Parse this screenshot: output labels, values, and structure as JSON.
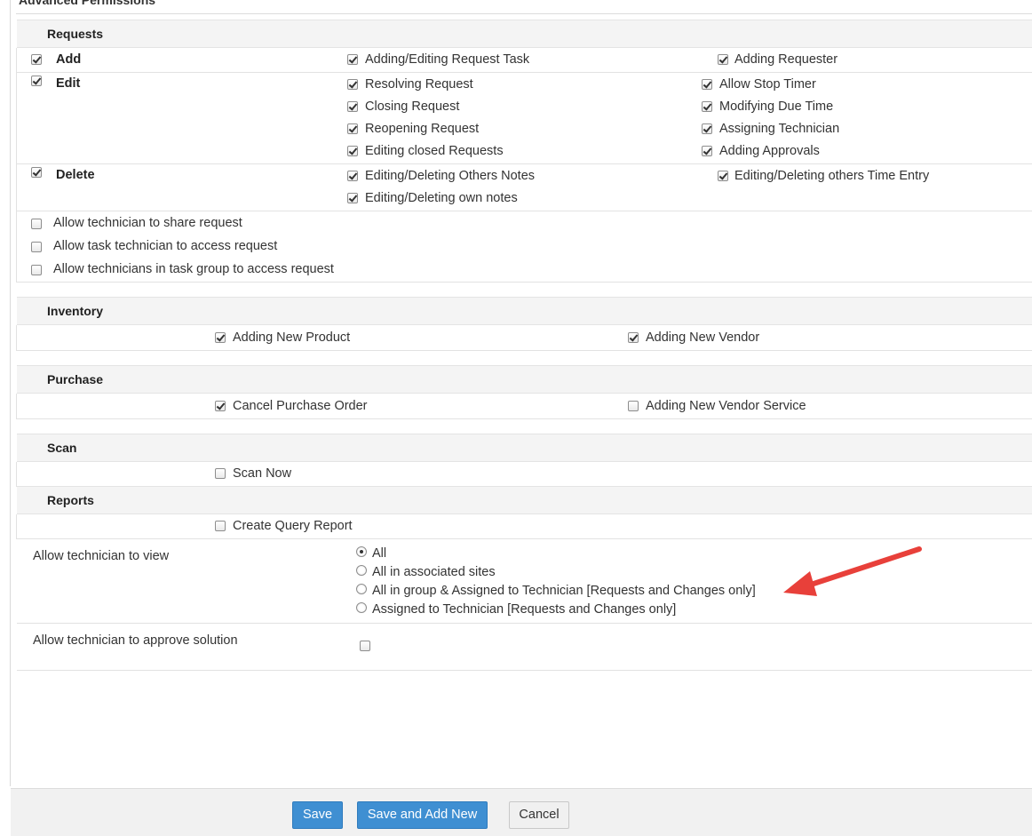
{
  "page": {
    "heading": "Advanced Permissions"
  },
  "requests": {
    "title": "Requests",
    "add": {
      "label": "Add",
      "items": [
        "Adding/Editing Request Task",
        "Adding Requester"
      ]
    },
    "edit": {
      "label": "Edit",
      "left_items": [
        "Resolving Request",
        "Closing Request",
        "Reopening Request",
        "Editing closed Requests"
      ],
      "right_items": [
        "Allow Stop Timer",
        "Modifying Due Time",
        "Assigning Technician",
        "Adding Approvals"
      ]
    },
    "delete": {
      "label": "Delete",
      "left_items": [
        "Editing/Deleting Others Notes",
        "Editing/Deleting own notes"
      ],
      "right_items": [
        "Editing/Deleting others Time Entry"
      ]
    },
    "options": [
      "Allow technician to share request",
      "Allow task technician to access request",
      "Allow technicians in task group to access request"
    ]
  },
  "inventory": {
    "title": "Inventory",
    "items": [
      "Adding New Product",
      "Adding New Vendor"
    ]
  },
  "purchase": {
    "title": "Purchase",
    "items": [
      "Cancel Purchase Order",
      "Adding New Vendor Service"
    ]
  },
  "scan": {
    "title": "Scan",
    "items": [
      "Scan Now"
    ]
  },
  "reports": {
    "title": "Reports",
    "items": [
      "Create Query Report"
    ]
  },
  "view": {
    "label": "Allow technician to view",
    "options": [
      "All",
      "All in associated sites",
      "All in group & Assigned to Technician [Requests and Changes only]",
      "Assigned to Technician [Requests and Changes only]"
    ],
    "selected": "All"
  },
  "approve": {
    "label": "Allow technician to approve solution"
  },
  "footer": {
    "save": "Save",
    "save_add": "Save and Add New",
    "cancel": "Cancel"
  },
  "colors": {
    "primary_button": "#3f8fd2",
    "annotation_arrow": "#e8403a",
    "section_header_bg": "#f4f4f4"
  }
}
